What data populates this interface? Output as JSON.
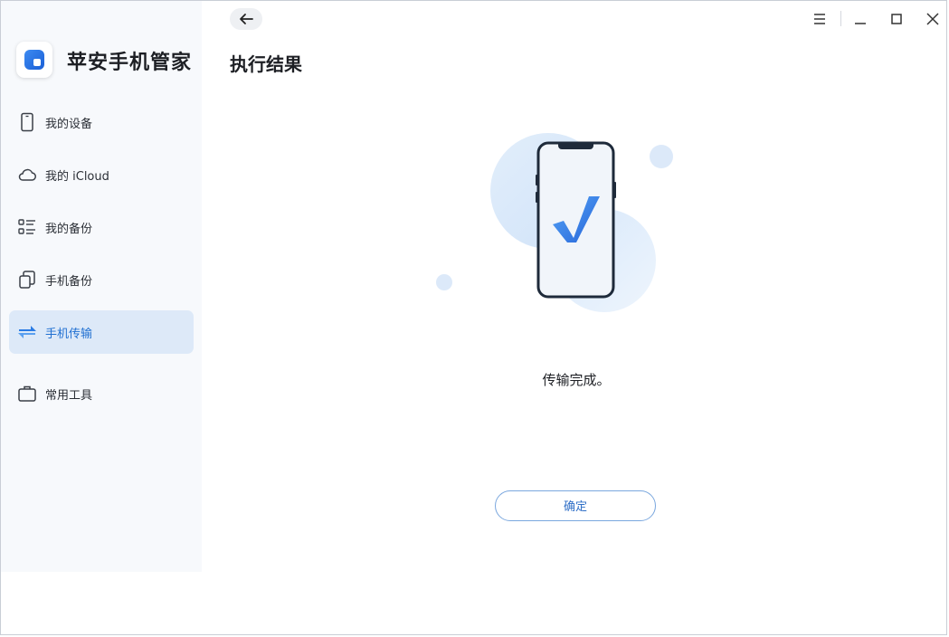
{
  "app": {
    "title": "苹安手机管家"
  },
  "sidebar": {
    "items": [
      {
        "label": "我的设备",
        "icon": "phone-icon",
        "active": false
      },
      {
        "label": "我的 iCloud",
        "icon": "cloud-icon",
        "active": false
      },
      {
        "label": "我的备份",
        "icon": "list-icon",
        "active": false
      },
      {
        "label": "手机备份",
        "icon": "copy-icon",
        "active": false
      },
      {
        "label": "手机传输",
        "icon": "transfer-icon",
        "active": true
      },
      {
        "label": "常用工具",
        "icon": "toolbox-icon",
        "active": false
      }
    ]
  },
  "header": {
    "page_title": "执行结果"
  },
  "main": {
    "result_message": "传输完成。",
    "confirm_label": "确定"
  },
  "colors": {
    "accent": "#1f6fd1",
    "active_bg": "#dde9f8",
    "sidebar_bg": "#f7f9fc"
  }
}
